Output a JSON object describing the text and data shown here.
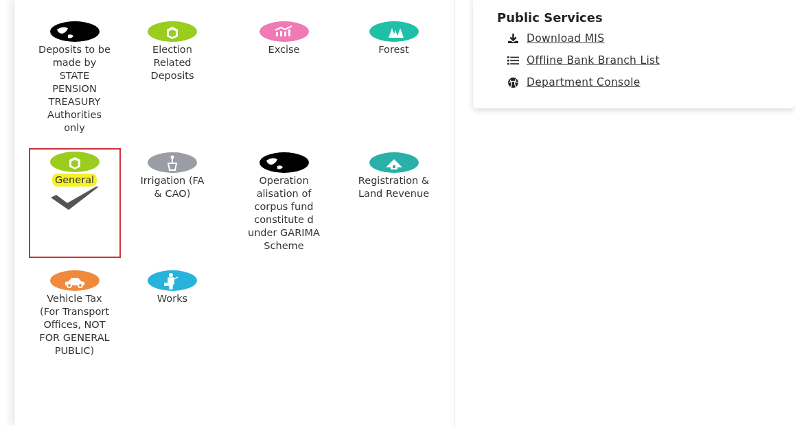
{
  "departments": [
    {
      "label": "Deposits to be made by STATE PENSION TREASURY Authorities only",
      "kind": "globe",
      "color": "#000000",
      "selected": false
    },
    {
      "label": "Election Related Deposits",
      "kind": "hexagon",
      "color": "#9acd1e",
      "selected": false
    },
    {
      "label": "Excise",
      "kind": "chart",
      "color": "#f07ab4",
      "selected": false
    },
    {
      "label": "Forest",
      "kind": "trees",
      "color": "#1fbfa8",
      "selected": false
    },
    {
      "label": "General",
      "kind": "hexagon",
      "color": "#9acd1e",
      "selected": true
    },
    {
      "label": "Irrigation (FA & CAO)",
      "kind": "plant",
      "color": "#9a9ea4",
      "selected": false
    },
    {
      "label": "Operation alisation of corpus fund constitute d under GARIMA Scheme",
      "kind": "globe",
      "color": "#000000",
      "selected": false
    },
    {
      "label": "Registration & Land Revenue",
      "kind": "house",
      "color": "#2ab0a8",
      "selected": false
    },
    {
      "label": "Vehicle Tax (For Transport Offices, NOT FOR GENERAL PUBLIC)",
      "kind": "car",
      "color": "#ef8a3c",
      "selected": false
    },
    {
      "label": "Works",
      "kind": "worker",
      "color": "#27b3dc",
      "selected": false
    }
  ],
  "public_services": {
    "title": "Public Services",
    "links": [
      {
        "label": "Download MIS",
        "kind": "download"
      },
      {
        "label": "Offline Bank Branch List",
        "kind": "list"
      },
      {
        "label": "Department Console",
        "kind": "console"
      }
    ]
  }
}
